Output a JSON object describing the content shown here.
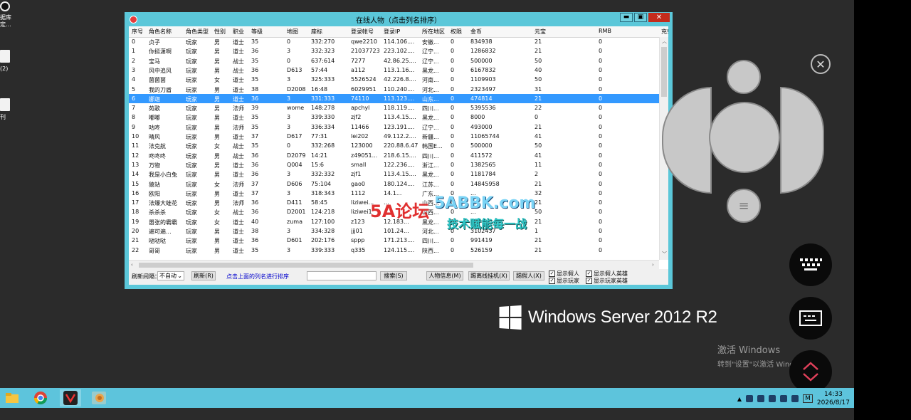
{
  "desktop": {
    "icons": [
      {
        "label": "据库\n定..."
      },
      {
        "label": "(2)"
      },
      {
        "label": "刊"
      }
    ],
    "os_logo_text": "Windows Server 2012 R2",
    "activation": {
      "line1": "激活 Windows",
      "line2": "转到\"设置\"以激活 Windows。"
    }
  },
  "window": {
    "title": "在线人物（点击列名排序）",
    "controls": {
      "minimize": "▬",
      "maximize": "▣",
      "close": "✕"
    }
  },
  "table": {
    "columns": [
      "序号",
      "角色名称",
      "角色类型",
      "性别",
      "职业",
      "等级",
      "地图",
      "座标",
      "登录帐号",
      "登录IP",
      "所在地区",
      "权限",
      "金币",
      "元宝",
      "RMB",
      "充!"
    ],
    "rows": [
      [
        "0",
        "贞子",
        "玩家",
        "男",
        "道士",
        "35",
        "0",
        "332:270",
        "qwe2210",
        "114.106....",
        "安徽...",
        "0",
        "834938",
        "21",
        "0"
      ],
      [
        "1",
        "你挺潇啊",
        "玩家",
        "男",
        "道士",
        "36",
        "3",
        "332:323",
        "21037723",
        "223.102....",
        "辽宁...",
        "0",
        "1286832",
        "21",
        "0"
      ],
      [
        "2",
        "宝马",
        "玩家",
        "男",
        "战士",
        "35",
        "0",
        "637:614",
        "7277",
        "42.86.25....",
        "辽宁...",
        "0",
        "500000",
        "50",
        "0"
      ],
      [
        "3",
        "风中追风",
        "玩家",
        "男",
        "战士",
        "36",
        "D613",
        "57:44",
        "a112",
        "113.1.16...",
        "黑龙...",
        "0",
        "6167832",
        "40",
        "0"
      ],
      [
        "4",
        "菌菌菌",
        "玩家",
        "女",
        "道士",
        "35",
        "3",
        "325:333",
        "5526524",
        "42.226.8....",
        "河南...",
        "0",
        "1109903",
        "50",
        "0"
      ],
      [
        "5",
        "我的刀盾",
        "玩家",
        "男",
        "道士",
        "38",
        "D2008",
        "16:48",
        "6029951",
        "110.240....",
        "河北...",
        "0",
        "2323497",
        "31",
        "0"
      ],
      [
        "6",
        "娜迦",
        "玩家",
        "男",
        "道士",
        "36",
        "3",
        "331:333",
        "74110",
        "113.123....",
        "山东...",
        "0",
        "474814",
        "21",
        "0"
      ],
      [
        "7",
        "苑歌",
        "玩家",
        "男",
        "法师",
        "39",
        "wome",
        "148:278",
        "apchyl",
        "118.119....",
        "四川...",
        "0",
        "5395536",
        "22",
        "0"
      ],
      [
        "8",
        "嘟嘟",
        "玩家",
        "男",
        "道士",
        "35",
        "3",
        "339:330",
        "zjf2",
        "113.4.15....",
        "黑龙...",
        "0",
        "8000",
        "0",
        "0"
      ],
      [
        "9",
        "咕咚",
        "玩家",
        "男",
        "法师",
        "35",
        "3",
        "336:334",
        "11466",
        "123.191....",
        "辽宁...",
        "0",
        "493000",
        "21",
        "0"
      ],
      [
        "10",
        "晴风",
        "玩家",
        "男",
        "道士",
        "37",
        "D617",
        "77:31",
        "lei202",
        "49.112.2....",
        "新疆...",
        "0",
        "11065744",
        "41",
        "0"
      ],
      [
        "11",
        "法克航",
        "玩家",
        "女",
        "战士",
        "35",
        "0",
        "332:268",
        "123000",
        "220.88.6.47",
        "韩国E...",
        "0",
        "500000",
        "50",
        "0"
      ],
      [
        "12",
        "咚咚咚",
        "玩家",
        "男",
        "战士",
        "36",
        "D2079",
        "14:21",
        "z49051...",
        "218.6.15....",
        "四川...",
        "0",
        "411572",
        "41",
        "0"
      ],
      [
        "13",
        "万物",
        "玩家",
        "男",
        "道士",
        "36",
        "Q004",
        "15:6",
        "small",
        "122.236....",
        "浙江...",
        "0",
        "1382565",
        "11",
        "0"
      ],
      [
        "14",
        "我是小白兔",
        "玩家",
        "男",
        "道士",
        "36",
        "3",
        "332:332",
        "zjf1",
        "113.4.15....",
        "黑龙...",
        "0",
        "1181784",
        "2",
        "0"
      ],
      [
        "15",
        "猿站",
        "玩家",
        "女",
        "法师",
        "37",
        "D606",
        "75:104",
        "gao0",
        "180.124....",
        "江苏...",
        "0",
        "14845958",
        "21",
        "0"
      ],
      [
        "16",
        "欧阳",
        "玩家",
        "男",
        "道士",
        "37",
        "3",
        "318:343",
        "1112",
        "14.1...",
        "广东...",
        "0",
        "...",
        "32",
        "0"
      ],
      [
        "17",
        "法爆大蛙花",
        "玩家",
        "男",
        "法师",
        "36",
        "D411",
        "58:45",
        "liziwei...",
        "...",
        "山西...",
        "0",
        "...",
        "21",
        "0"
      ],
      [
        "18",
        "杀杀杀",
        "玩家",
        "女",
        "战士",
        "36",
        "D2001",
        "124:218",
        "liziwei1",
        "...",
        "山西...",
        "0",
        "...",
        "50",
        "0"
      ],
      [
        "19",
        "嚣张的霸霸",
        "玩家",
        "女",
        "道士",
        "40",
        "zuma",
        "127:100",
        "z123",
        "12.183...",
        "黑龙...",
        "0",
        "...",
        "21",
        "0"
      ],
      [
        "20",
        "遍可遍...",
        "玩家",
        "男",
        "道士",
        "38",
        "3",
        "334:328",
        "jjj01",
        "101.24...",
        "河北...",
        "0",
        "3102437",
        "1",
        "0"
      ],
      [
        "21",
        "哒哒哒",
        "玩家",
        "男",
        "道士",
        "36",
        "D601",
        "202:176",
        "sppp",
        "171.213....",
        "四川...",
        "0",
        "991419",
        "21",
        "0"
      ],
      [
        "22",
        "哥哥",
        "玩家",
        "男",
        "道士",
        "35",
        "3",
        "339:333",
        "q335",
        "124.115....",
        "陕西...",
        "0",
        "526159",
        "21",
        "0"
      ]
    ],
    "selected_row": 6
  },
  "toolbar": {
    "refresh_interval_label": "刷新间隔：",
    "refresh_interval_value": "不自动",
    "refresh_button": "刷新(R)",
    "hint": "点击上面的列名进行排序",
    "search_button": "搜索(S)",
    "info_button": "人物信息(M)",
    "kick_button": "踢离线挂机(X)",
    "kick_user_button": "踢假人(X)",
    "chk_show_fake": "显示假人",
    "chk_show_player": "显示玩家",
    "chk_show_fake_hero": "显示假人英雄",
    "chk_show_player_hero": "显示玩家英雄"
  },
  "watermark": {
    "logo": "5A论坛",
    "site": "5ABBK.com",
    "slogan": "技术赋能每一战"
  },
  "taskbar": {
    "time": "14:33",
    "date": "2026/8/17",
    "ime": "M"
  },
  "colors": {
    "taskbar": "#5dc4dc",
    "window_frame": "#5bc7d9",
    "selection": "#3399ff",
    "close": "#c42b1c"
  }
}
